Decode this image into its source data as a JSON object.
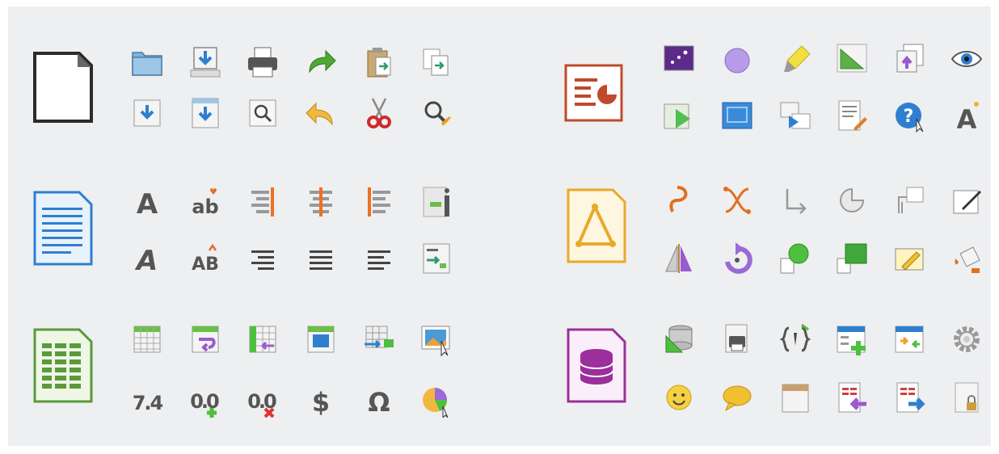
{
  "sheet": {
    "background": "#eeeff0"
  },
  "suites": [
    {
      "name": "generic-document",
      "accent": "#333333"
    },
    {
      "name": "impress",
      "accent": "#c0492a"
    },
    {
      "name": "writer",
      "accent": "#2f7fd0"
    },
    {
      "name": "draw",
      "accent": "#e8a92a"
    },
    {
      "name": "calc",
      "accent": "#5b9a3a"
    },
    {
      "name": "base",
      "accent": "#9b2f9b"
    }
  ],
  "glyphs": {
    "bold_a": "A",
    "ab": "ab",
    "ab_caps": "AB",
    "number_format": "7.4",
    "decimal_add": "0.0",
    "decimal_delete": "0.0",
    "currency": "$",
    "omega": "Ω",
    "font_a": "A"
  }
}
